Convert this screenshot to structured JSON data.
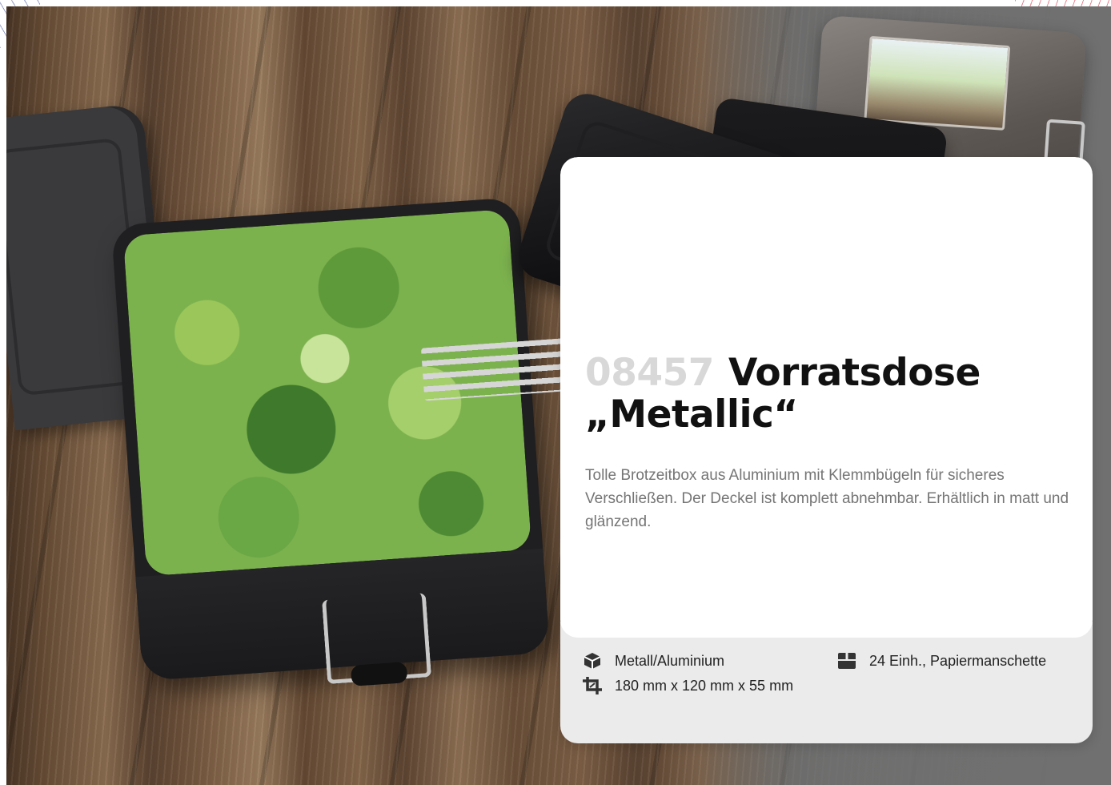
{
  "product": {
    "article_number": "08457",
    "name_line1": "Vorratsdose",
    "name_line2": "„Metallic“",
    "description": "Tolle Brotzeitbox aus Aluminium mit Klemmbügeln für sicheres Verschließen. Der Deckel ist komplett abnehmbar. Erhältlich in matt und glänzend."
  },
  "specs": {
    "material": {
      "icon": "box-icon",
      "text": "Metall/Aluminium"
    },
    "dimensions": {
      "icon": "crop-size-icon",
      "text": "180 mm x 120 mm x 55 mm"
    },
    "packaging": {
      "icon": "package-icon",
      "text": "24 Einh., Papiermanschette"
    }
  },
  "colors": {
    "title": "#111111",
    "article_number": "#d8d8d8",
    "description": "#757575",
    "card_bottom": "#ebebeb"
  }
}
